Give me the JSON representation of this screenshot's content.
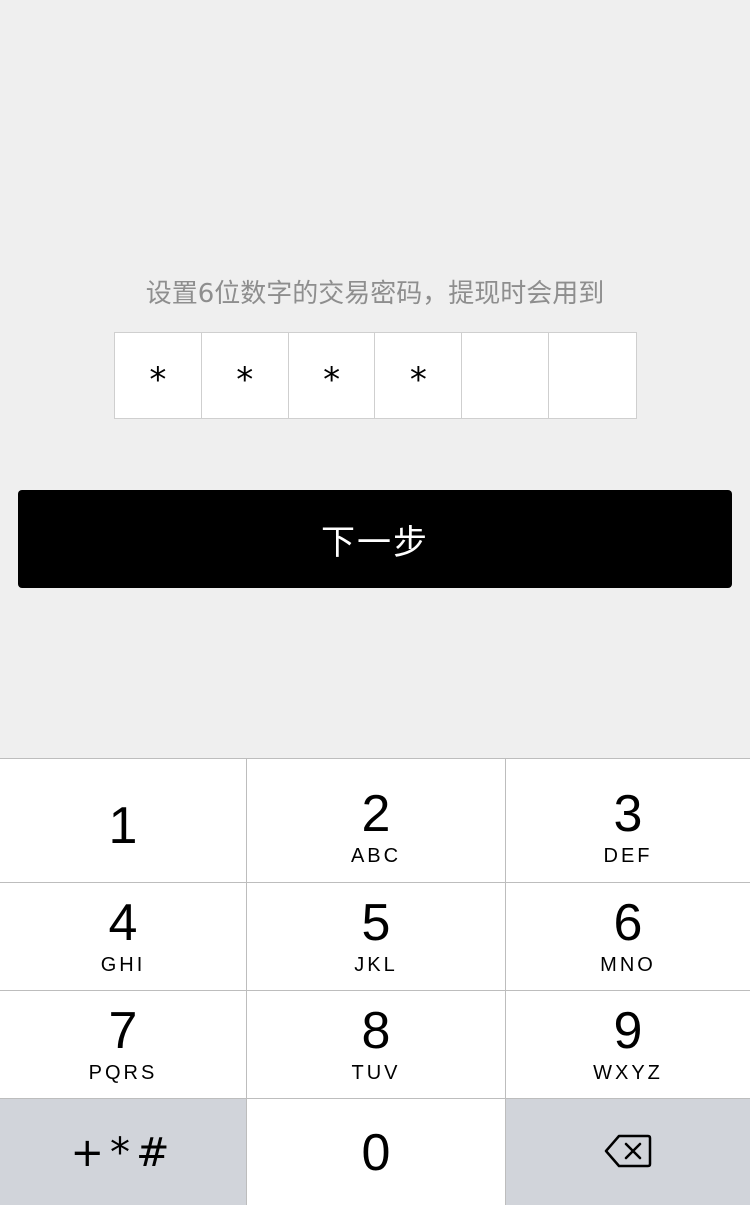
{
  "prompt": "设置6位数字的交易密码，提现时会用到",
  "pin": [
    "*",
    "*",
    "*",
    "*",
    "",
    ""
  ],
  "next_button": "下一步",
  "keypad": {
    "k1": {
      "num": "1",
      "letters": ""
    },
    "k2": {
      "num": "2",
      "letters": "ABC"
    },
    "k3": {
      "num": "3",
      "letters": "DEF"
    },
    "k4": {
      "num": "4",
      "letters": "GHI"
    },
    "k5": {
      "num": "5",
      "letters": "JKL"
    },
    "k6": {
      "num": "6",
      "letters": "MNO"
    },
    "k7": {
      "num": "7",
      "letters": "PQRS"
    },
    "k8": {
      "num": "8",
      "letters": "TUV"
    },
    "k9": {
      "num": "9",
      "letters": "WXYZ"
    },
    "symbols": "+*#",
    "k0": {
      "num": "0"
    },
    "delete_icon": "backspace-icon"
  },
  "colors": {
    "background": "#efefef",
    "button": "#000000",
    "button_text": "#ffffff",
    "hint_text": "#8e8e8e",
    "gray_key": "#d1d4da"
  }
}
